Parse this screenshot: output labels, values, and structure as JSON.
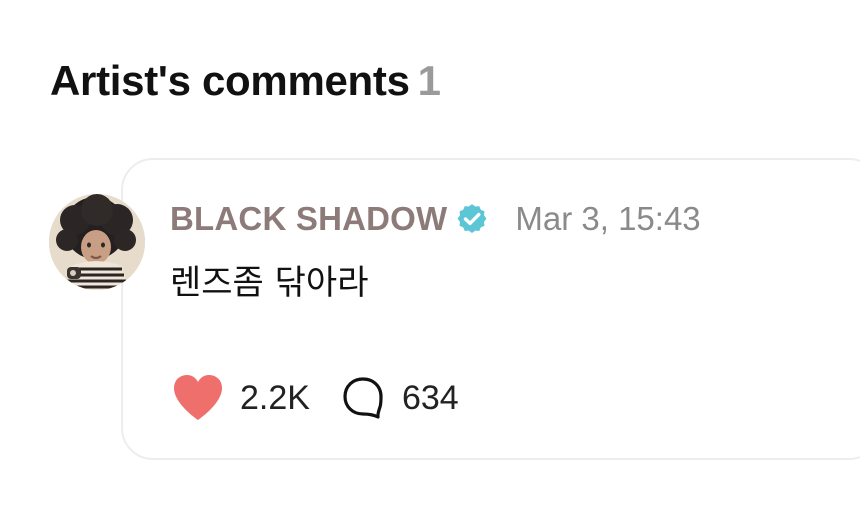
{
  "section": {
    "title": "Artist's comments",
    "count": "1"
  },
  "comment": {
    "author": "BLACK SHADOW",
    "verified": true,
    "timestamp": "Mar 3, 15:43",
    "text": "렌즈좀 닦아라",
    "likes": "2.2K",
    "replies": "634"
  },
  "icons": {
    "verified": "verified-badge-icon",
    "like": "heart-icon",
    "reply": "speech-bubble-icon"
  },
  "colors": {
    "author": "#8c7b79",
    "verified_badge": "#5cc6d6",
    "heart": "#ef6f6c",
    "count_badge": "#9a9a9a",
    "card_border": "#ededf0"
  }
}
